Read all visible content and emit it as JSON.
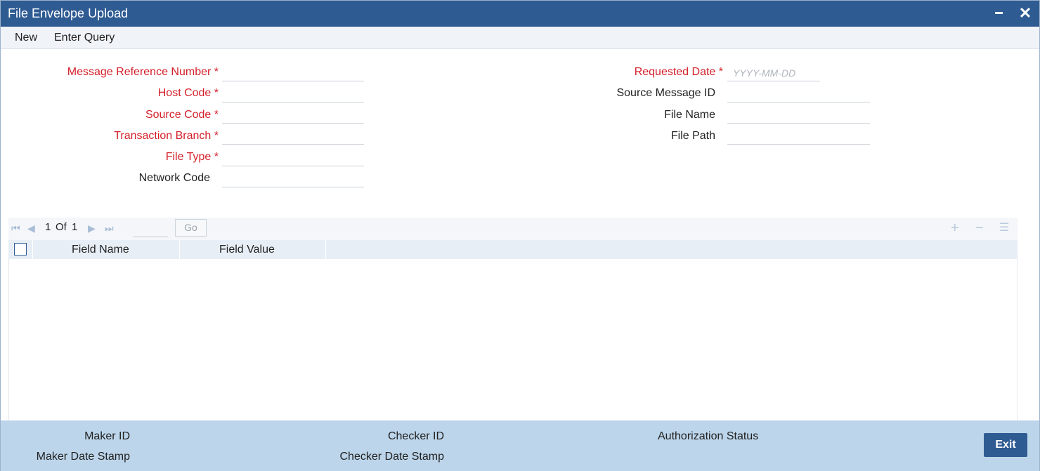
{
  "window": {
    "title": "File Envelope Upload",
    "close_glyph": "✕",
    "icons": [
      "minimize-icon",
      "close-icon"
    ]
  },
  "menu": {
    "new_label": "New",
    "query_label": "Enter Query"
  },
  "form": {
    "message_reference_number": {
      "label": "Message Reference Number *",
      "value": ""
    },
    "host_code": {
      "label": "Host Code *",
      "value": ""
    },
    "source_code": {
      "label": "Source Code *",
      "value": ""
    },
    "transaction_branch": {
      "label": "Transaction Branch *",
      "value": ""
    },
    "file_type": {
      "label": "File Type *",
      "value": ""
    },
    "network_code": {
      "label": "Network Code",
      "value": ""
    },
    "requested_date": {
      "label": "Requested Date *",
      "value": "",
      "placeholder": "YYYY-MM-DD"
    },
    "source_message_id": {
      "label": "Source Message ID",
      "value": ""
    },
    "file_name": {
      "label": "File Name",
      "value": ""
    },
    "file_path": {
      "label": "File Path",
      "value": ""
    }
  },
  "grid": {
    "pagination": {
      "current": "1",
      "of_label": "Of",
      "total": "1",
      "go_label": "Go"
    },
    "columns": [
      "Field Name",
      "Field Value"
    ],
    "rows": [],
    "toolbar_icons": [
      "add-row-icon",
      "delete-row-icon",
      "single-view-icon"
    ]
  },
  "footer": {
    "maker_id": "Maker ID",
    "maker_date_stamp": "Maker Date Stamp",
    "checker_id": "Checker ID",
    "checker_date_stamp": "Checker Date Stamp",
    "authorization_status": "Authorization Status",
    "exit_label": "Exit"
  },
  "colors": {
    "title_bar": "#2f5b93",
    "required_label": "#d4202a",
    "footer": "#bcd5ea"
  }
}
